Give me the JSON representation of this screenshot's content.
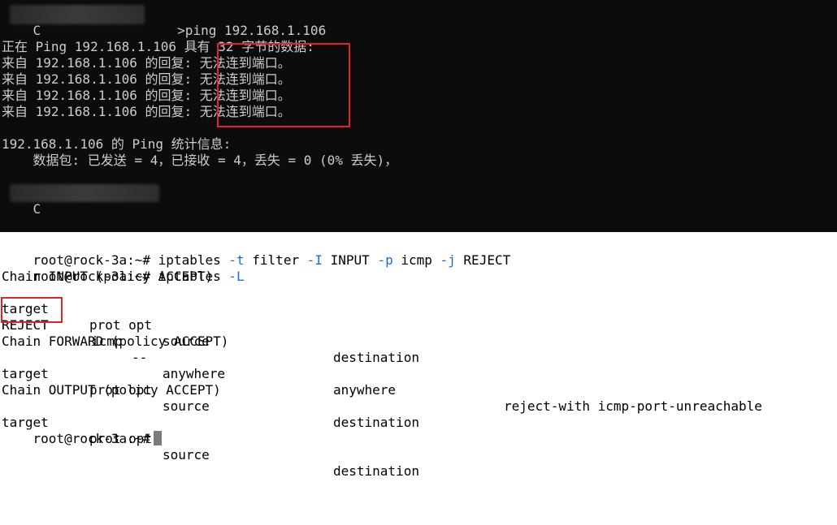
{
  "windows_console": {
    "command": ">ping 192.168.1.106",
    "blurred_prefix_char": "C",
    "lines": [
      "正在 Ping 192.168.1.106 具有 32 字节的数据:",
      "来自 192.168.1.106 的回复: 无法连到端口。",
      "来自 192.168.1.106 的回复: 无法连到端口。",
      "来自 192.168.1.106 的回复: 无法连到端口。",
      "来自 192.168.1.106 的回复: 无法连到端口。"
    ],
    "stats_title": "192.168.1.106 的 Ping 统计信息:",
    "stats_line": "    数据包: 已发送 = 4，已接收 = 4，丢失 = 0 (0% 丢失)，",
    "bottom_prompt_char": "C"
  },
  "linux_terminal": {
    "prompt": "root@rock-3a:~#",
    "cmd1": {
      "name": "iptables",
      "parts": [
        {
          "t": "-t",
          "flag": true
        },
        {
          "t": "filter",
          "flag": false
        },
        {
          "t": "-I",
          "flag": true
        },
        {
          "t": "INPUT",
          "flag": false
        },
        {
          "t": "-p",
          "flag": true
        },
        {
          "t": "icmp",
          "flag": false
        },
        {
          "t": "-j",
          "flag": true
        },
        {
          "t": "REJECT",
          "flag": false
        }
      ]
    },
    "cmd2": {
      "name": "iptables",
      "flag": "-L"
    },
    "chains": [
      {
        "title": "Chain INPUT (policy ACCEPT)",
        "header": {
          "target": "target",
          "prot_opt": "prot opt",
          "source": "source",
          "destination": "destination"
        },
        "rows": [
          {
            "target": "REJECT",
            "prot": "icmp",
            "opt": "--",
            "source": "anywhere",
            "destination": "anywhere",
            "extra": "reject-with icmp-port-unreachable"
          }
        ]
      },
      {
        "title": "Chain FORWARD (policy ACCEPT)",
        "header": {
          "target": "target",
          "prot_opt": "prot opt",
          "source": "source",
          "destination": "destination"
        },
        "rows": []
      },
      {
        "title": "Chain OUTPUT (policy ACCEPT)",
        "header": {
          "target": "target",
          "prot_opt": "prot opt",
          "source": "source",
          "destination": "destination"
        },
        "rows": []
      }
    ]
  },
  "colors": {
    "highlight_box": "#e0242b",
    "flag_blue": "#1f6ad6",
    "console_bg": "#0c0c0c"
  }
}
